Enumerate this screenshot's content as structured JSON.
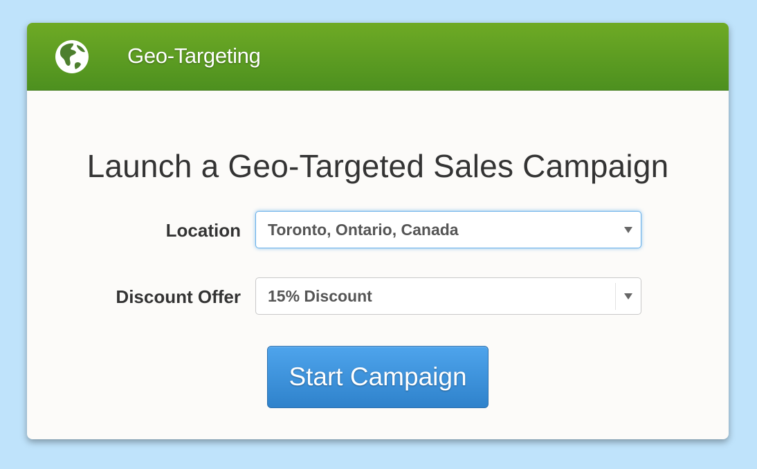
{
  "header": {
    "title": "Geo-Targeting",
    "icon": "globe-icon"
  },
  "main": {
    "title": "Launch a Geo-Targeted Sales Campaign",
    "location": {
      "label": "Location",
      "value": "Toronto, Ontario, Canada"
    },
    "discount": {
      "label": "Discount Offer",
      "value": "15% Discount"
    },
    "start_button_label": "Start Campaign"
  },
  "colors": {
    "background": "#bfe3fb",
    "header_green": "#5e9e22",
    "button_blue": "#3b8fd9",
    "focus_blue": "#66afe9"
  }
}
